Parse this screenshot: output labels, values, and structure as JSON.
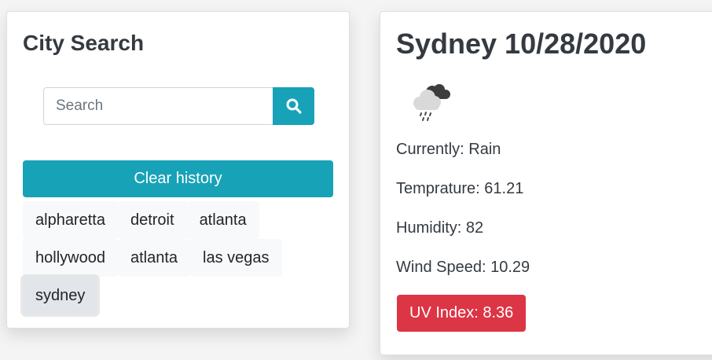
{
  "search_panel": {
    "title": "City Search",
    "search_placeholder": "Search",
    "search_value": "",
    "clear_label": "Clear history",
    "history": [
      {
        "label": "alpharetta",
        "active": false
      },
      {
        "label": "detroit",
        "active": false
      },
      {
        "label": "atlanta",
        "active": false
      },
      {
        "label": "hollywood",
        "active": false
      },
      {
        "label": "atlanta",
        "active": false
      },
      {
        "label": "las vegas",
        "active": false
      },
      {
        "label": "sydney",
        "active": true
      }
    ]
  },
  "weather": {
    "title": "Sydney 10/28/2020",
    "icon": "rain-cloud-icon",
    "currently": "Currently: Rain",
    "temperature": "Temprature: 61.21",
    "humidity": "Humidity: 82",
    "wind_speed": "Wind Speed: 10.29",
    "uv_index": "UV Index: 8.36"
  },
  "colors": {
    "accent": "#17a2b8",
    "uv_danger": "#dc3545",
    "history_bg": "#f8f9fa"
  }
}
